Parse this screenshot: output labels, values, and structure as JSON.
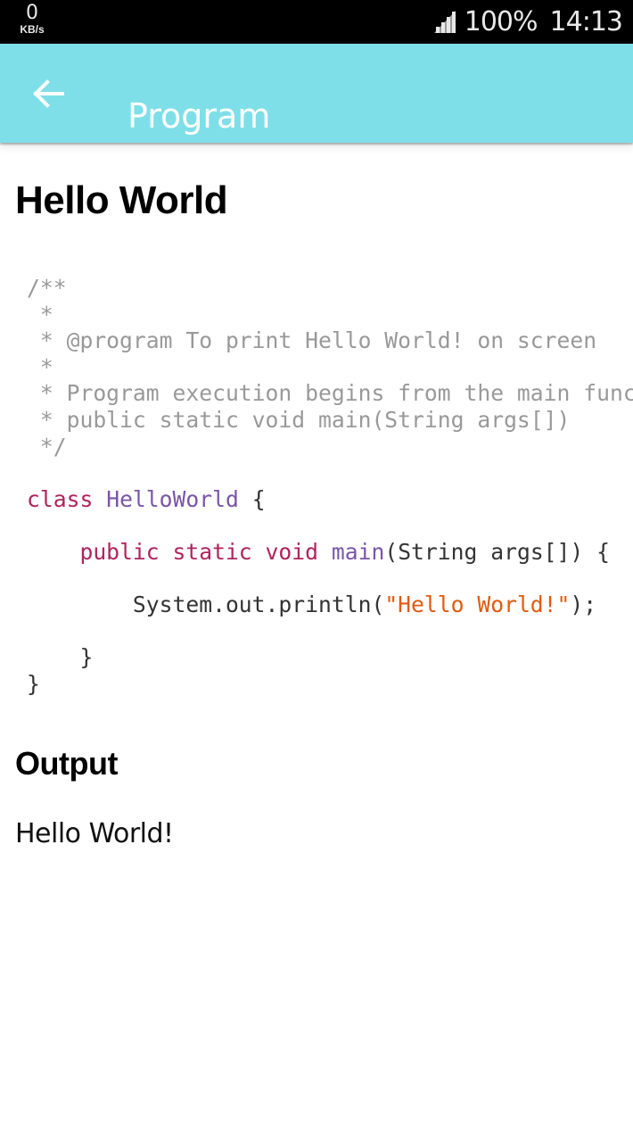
{
  "status_bar": {
    "net_speed_value": "0",
    "net_speed_unit": "KB/s",
    "signal_icon": "cell-signal-icon",
    "battery": "100%",
    "time": "14:13"
  },
  "app_bar": {
    "back_icon": "arrow-left-icon",
    "title": "Program",
    "background_color": "#7fdfe9"
  },
  "content": {
    "title": "Hello World",
    "code": {
      "language": "java",
      "lines": [
        [
          {
            "t": "comment",
            "s": "/**"
          }
        ],
        [
          {
            "t": "comment",
            "s": " *"
          }
        ],
        [
          {
            "t": "comment",
            "s": " * @program To print Hello World! on screen"
          }
        ],
        [
          {
            "t": "comment",
            "s": " *"
          }
        ],
        [
          {
            "t": "comment",
            "s": " * Program execution begins from the main function"
          }
        ],
        [
          {
            "t": "comment",
            "s": " * public static void main(String args[])"
          }
        ],
        [
          {
            "t": "comment",
            "s": " */"
          }
        ],
        [],
        [
          {
            "t": "keyword",
            "s": "class"
          },
          {
            "t": "plain",
            "s": " "
          },
          {
            "t": "type",
            "s": "HelloWorld"
          },
          {
            "t": "plain",
            "s": " {"
          }
        ],
        [],
        [
          {
            "t": "plain",
            "s": "    "
          },
          {
            "t": "keyword",
            "s": "public static void"
          },
          {
            "t": "plain",
            "s": " "
          },
          {
            "t": "type",
            "s": "main"
          },
          {
            "t": "plain",
            "s": "(String args[]) {"
          }
        ],
        [],
        [
          {
            "t": "plain",
            "s": "        System.out.println("
          },
          {
            "t": "string",
            "s": "\"Hello World!\""
          },
          {
            "t": "plain",
            "s": ");"
          }
        ],
        [],
        [
          {
            "t": "plain",
            "s": "    }"
          }
        ],
        [
          {
            "t": "plain",
            "s": "}"
          }
        ]
      ],
      "colors": {
        "comment": "#999999",
        "keyword": "#b0235e",
        "type": "#7a55a8",
        "plain": "#333333",
        "string": "#e05b10"
      }
    },
    "output_heading": "Output",
    "output_text": "Hello World!"
  }
}
